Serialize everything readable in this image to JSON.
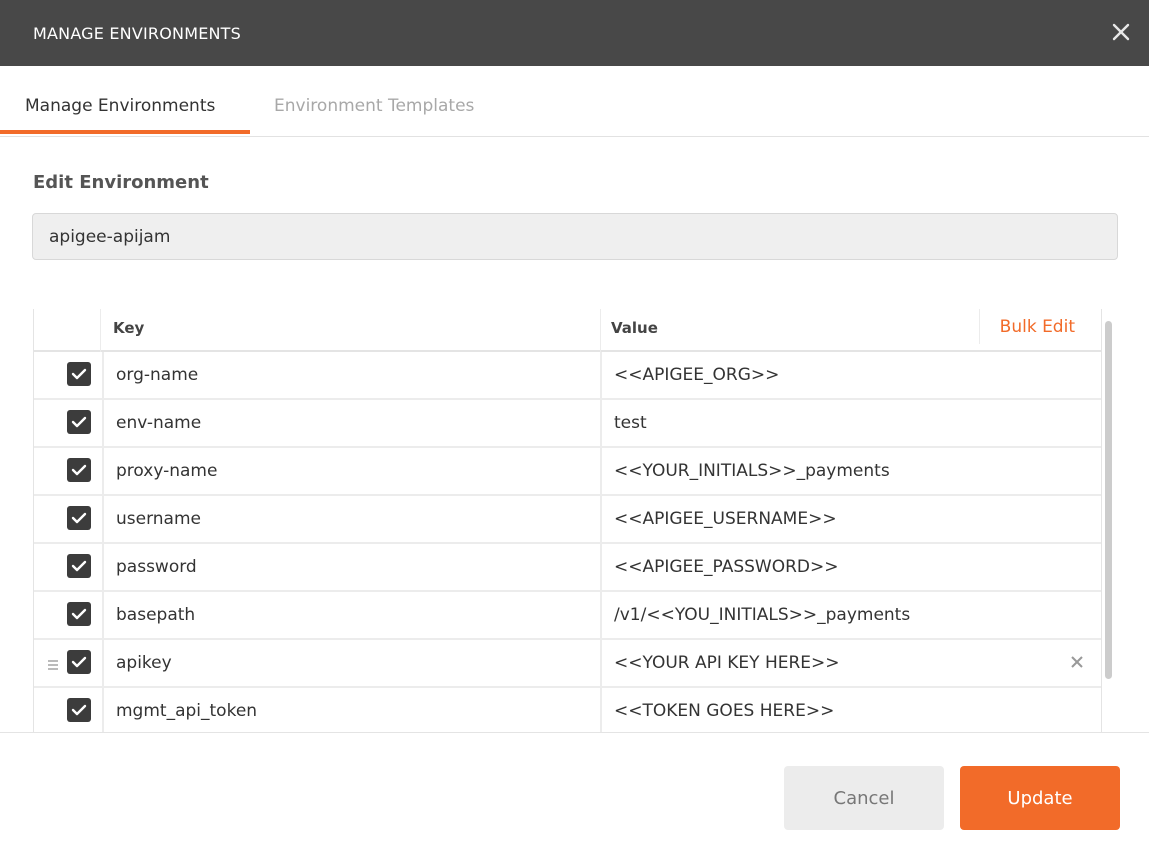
{
  "window": {
    "title": "MANAGE ENVIRONMENTS",
    "close_icon": "close-icon"
  },
  "tabs": [
    {
      "label": "Manage Environments",
      "active": true
    },
    {
      "label": "Environment Templates",
      "active": false
    }
  ],
  "edit": {
    "section_title": "Edit Environment",
    "environment_name": "apigee-apijam"
  },
  "table": {
    "headers": {
      "key": "Key",
      "value": "Value"
    },
    "bulk_edit_label": "Bulk Edit",
    "rows": [
      {
        "key": "org-name",
        "value": "<<APIGEE_ORG>>",
        "checked": true
      },
      {
        "key": "env-name",
        "value": "test",
        "checked": true
      },
      {
        "key": "proxy-name",
        "value": "<<YOUR_INITIALS>>_payments",
        "checked": true
      },
      {
        "key": "username",
        "value": "<<APIGEE_USERNAME>>",
        "checked": true
      },
      {
        "key": "password",
        "value": "<<APIGEE_PASSWORD>>",
        "checked": true
      },
      {
        "key": "basepath",
        "value": "/v1/<<YOU_INITIALS>>_payments",
        "checked": true
      },
      {
        "key": "apikey",
        "value": "<<YOUR API KEY HERE>>",
        "checked": true,
        "hovered": true
      },
      {
        "key": "mgmt_api_token",
        "value": "<<TOKEN GOES HERE>>",
        "checked": true
      }
    ]
  },
  "footer": {
    "cancel_label": "Cancel",
    "update_label": "Update"
  },
  "colors": {
    "accent": "#f26b29",
    "titlebar": "#484848",
    "checkbox": "#3c3c3c"
  }
}
